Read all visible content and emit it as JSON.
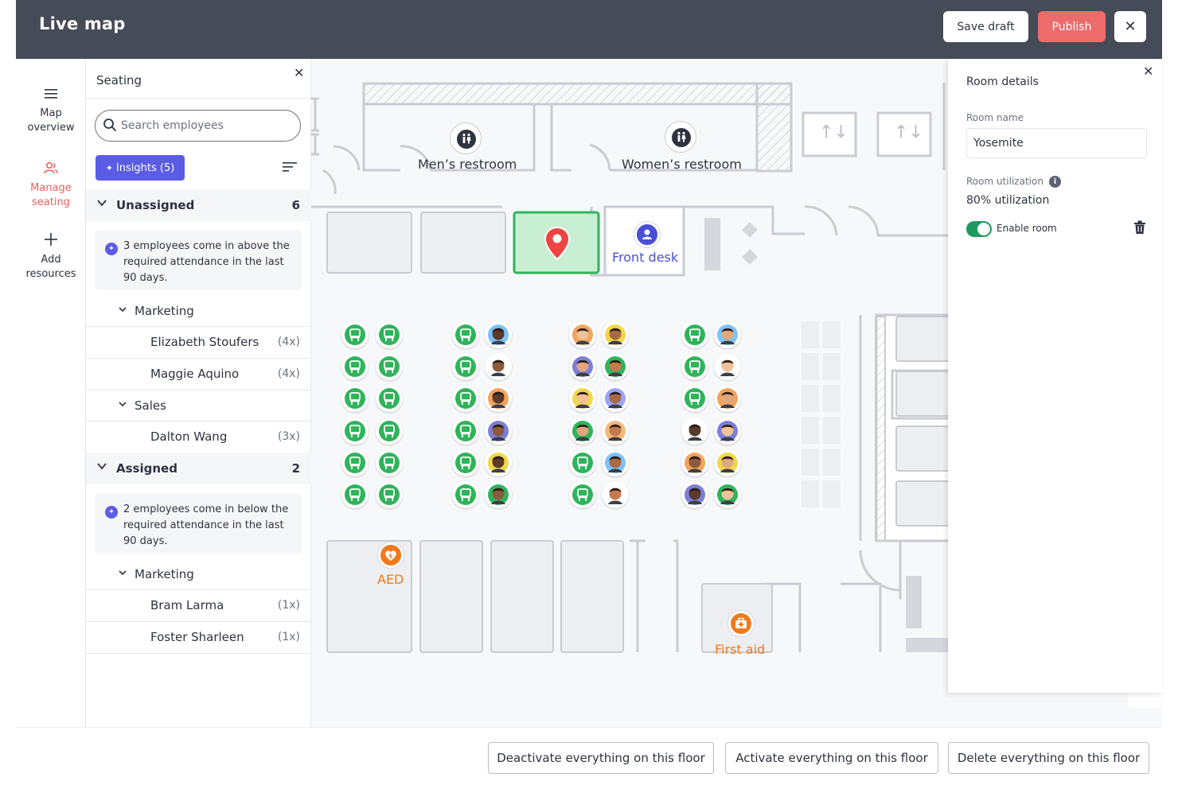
{
  "header": {
    "title": "Live map",
    "save_draft_label": "Save draft",
    "publish_label": "Publish",
    "close_glyph": "✕"
  },
  "rail": {
    "items": [
      {
        "label": "Map overview",
        "icon": "hamburger-icon",
        "glyph": "≡"
      },
      {
        "label": "Manage seating",
        "icon": "people-icon",
        "glyph": "⚇",
        "active": true
      },
      {
        "label": "Add resources",
        "icon": "plus-icon",
        "glyph": "+"
      }
    ]
  },
  "seating": {
    "title": "Seating",
    "search_placeholder": "Search employees",
    "insights_label": "Insights (5)",
    "groups": [
      {
        "label": "Unassigned",
        "count": "6",
        "insight": "3 employees come in above the required attendance in the last 90 days.",
        "departments": [
          {
            "label": "Marketing",
            "employees": [
              {
                "name": "Elizabeth Stoufers",
                "days": "(4x)"
              },
              {
                "name": "Maggie Aquino",
                "days": "(4x)"
              }
            ]
          },
          {
            "label": "Sales",
            "employees": [
              {
                "name": "Dalton Wang",
                "days": "(3x)"
              }
            ]
          }
        ]
      },
      {
        "label": "Assigned",
        "count": "2",
        "insight": "2 employees come in below the required attendance in the last 90 days.",
        "departments": [
          {
            "label": "Marketing",
            "employees": [
              {
                "name": "Bram Larma",
                "days": "(1x)"
              },
              {
                "name": "Foster Sharleen",
                "days": "(1x)"
              }
            ]
          }
        ]
      }
    ]
  },
  "map": {
    "labels": {
      "mens_restroom": "Men’s restroom",
      "womens_restroom": "Women’s restroom",
      "front_desk": "Front desk",
      "aed": "AED",
      "first_aid": "First aid"
    },
    "colors": {
      "selected_room_fill": "#c9efd3",
      "selected_room_border": "#2fb45a",
      "desk_green": "#2fb45a",
      "pin_red": "#ef4444",
      "front_desk_purple": "#4b4ed6",
      "safety_orange": "#f07a1b"
    }
  },
  "room_details": {
    "title": "Room details",
    "room_name_label": "Room name",
    "room_name_value": "Yosemite",
    "utilization_label": "Room utilization",
    "utilization_value": "80% utilization",
    "enable_label": "Enable room",
    "enabled": true
  },
  "footer": {
    "deactivate_label": "Deactivate everything on this floor",
    "activate_label": "Activate everything on this floor",
    "delete_label": "Delete everything on this floor"
  }
}
